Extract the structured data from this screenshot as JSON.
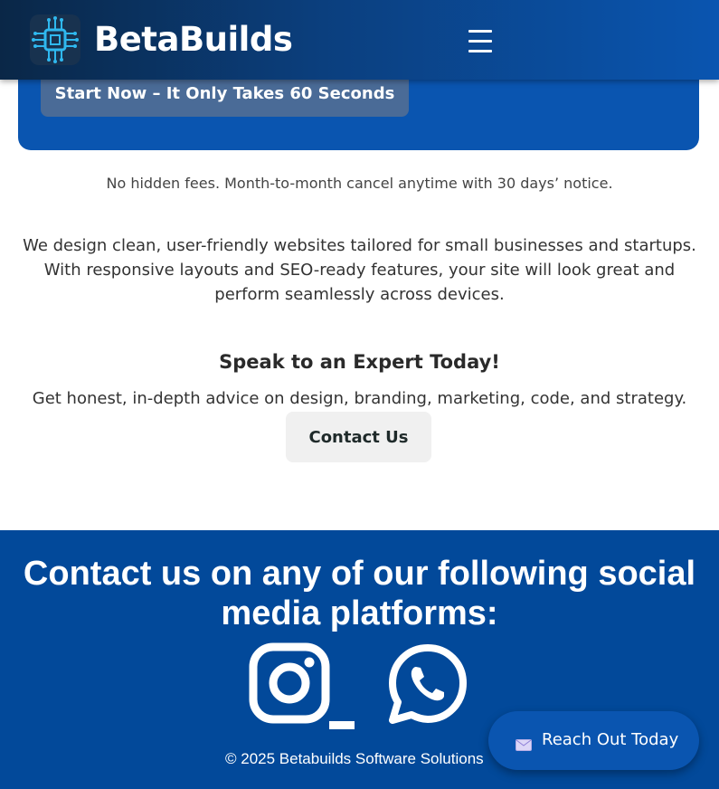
{
  "header": {
    "brand": "BetaBuilds",
    "logo_icon": "circuit-chip-icon",
    "menu_icon": "hamburger-menu-icon"
  },
  "hero": {
    "cta_label": "Start Now – It Only Takes 60 Seconds"
  },
  "fees_note": "No hidden fees. Month-to-month cancel anytime with 30 days’ notice.",
  "description": "We design clean, user-friendly websites tailored for small businesses and startups. With responsive layouts and SEO-ready features, your site will look great and perform seamlessly across devices.",
  "expert": {
    "title": "Speak to an Expert Today!",
    "subtitle": "Get honest, in-depth advice on design, branding, marketing, code, and strategy.",
    "button_label": "Contact Us"
  },
  "footer": {
    "title": "Contact us on any of our following social media platforms:",
    "social_icons": [
      "instagram-icon",
      "whatsapp-icon"
    ],
    "copyright": "© 2025 Betabuilds Software Solutions"
  },
  "floating_button": {
    "label": "Reach Out Today",
    "icon": "envelope-icon"
  },
  "colors": {
    "primary": "#0a55b0",
    "footer": "#02499a",
    "header_dark": "#0a2747"
  }
}
